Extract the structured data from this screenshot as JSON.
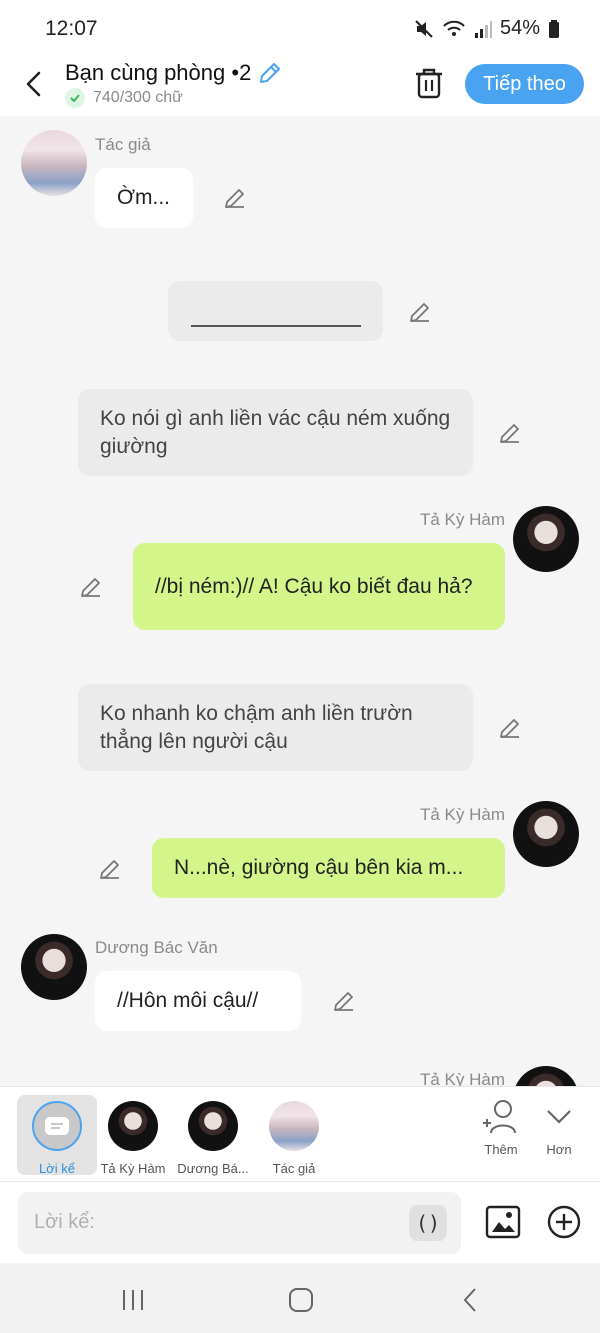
{
  "status": {
    "time": "12:07",
    "battery": "54%"
  },
  "header": {
    "title": "Bạn cùng phòng •2",
    "word_count": "740/300 chữ",
    "next_label": "Tiếp theo"
  },
  "messages": [
    {
      "type": "left",
      "sender": "Tác giả",
      "text": "Ờm..."
    },
    {
      "type": "divider",
      "text": ""
    },
    {
      "type": "narration",
      "text": "Ko nói gì anh liền vác cậu ném xuống giường"
    },
    {
      "type": "right",
      "sender": "Tả Kỳ Hàm",
      "text": "//bị ném:)// A! Cậu ko biết đau hả?"
    },
    {
      "type": "narration",
      "text": "Ko nhanh ko chậm anh liền trườn thẳng lên người cậu"
    },
    {
      "type": "right",
      "sender": "Tả Kỳ Hàm",
      "text": "N...nè, giường cậu bên kia m..."
    },
    {
      "type": "left",
      "sender": "Dương Bác Văn",
      "text": "//Hôn môi cậu//"
    },
    {
      "type": "right-partial",
      "sender": "Tả Kỳ Hàm",
      "text": ""
    }
  ],
  "characters": {
    "narration_label": "Lời kể",
    "items": [
      {
        "label": "Tả Kỳ Hàm"
      },
      {
        "label": "Dương Bá..."
      },
      {
        "label": "Tác giả"
      }
    ],
    "add_label": "Thêm",
    "more_label": "Hơn"
  },
  "composer": {
    "placeholder": "Lời kể:",
    "paren_label": "()"
  },
  "colors": {
    "accent": "#4aa3f0",
    "green_bubble": "#d3f58a",
    "grey_bubble": "#ebebeb"
  },
  "icons": [
    "back-icon",
    "pencil-icon",
    "check-icon",
    "trash-icon",
    "add-person-icon",
    "chevron-down-icon",
    "image-icon",
    "plus-circle-icon",
    "recent-apps-icon",
    "home-icon",
    "nav-back-icon"
  ]
}
